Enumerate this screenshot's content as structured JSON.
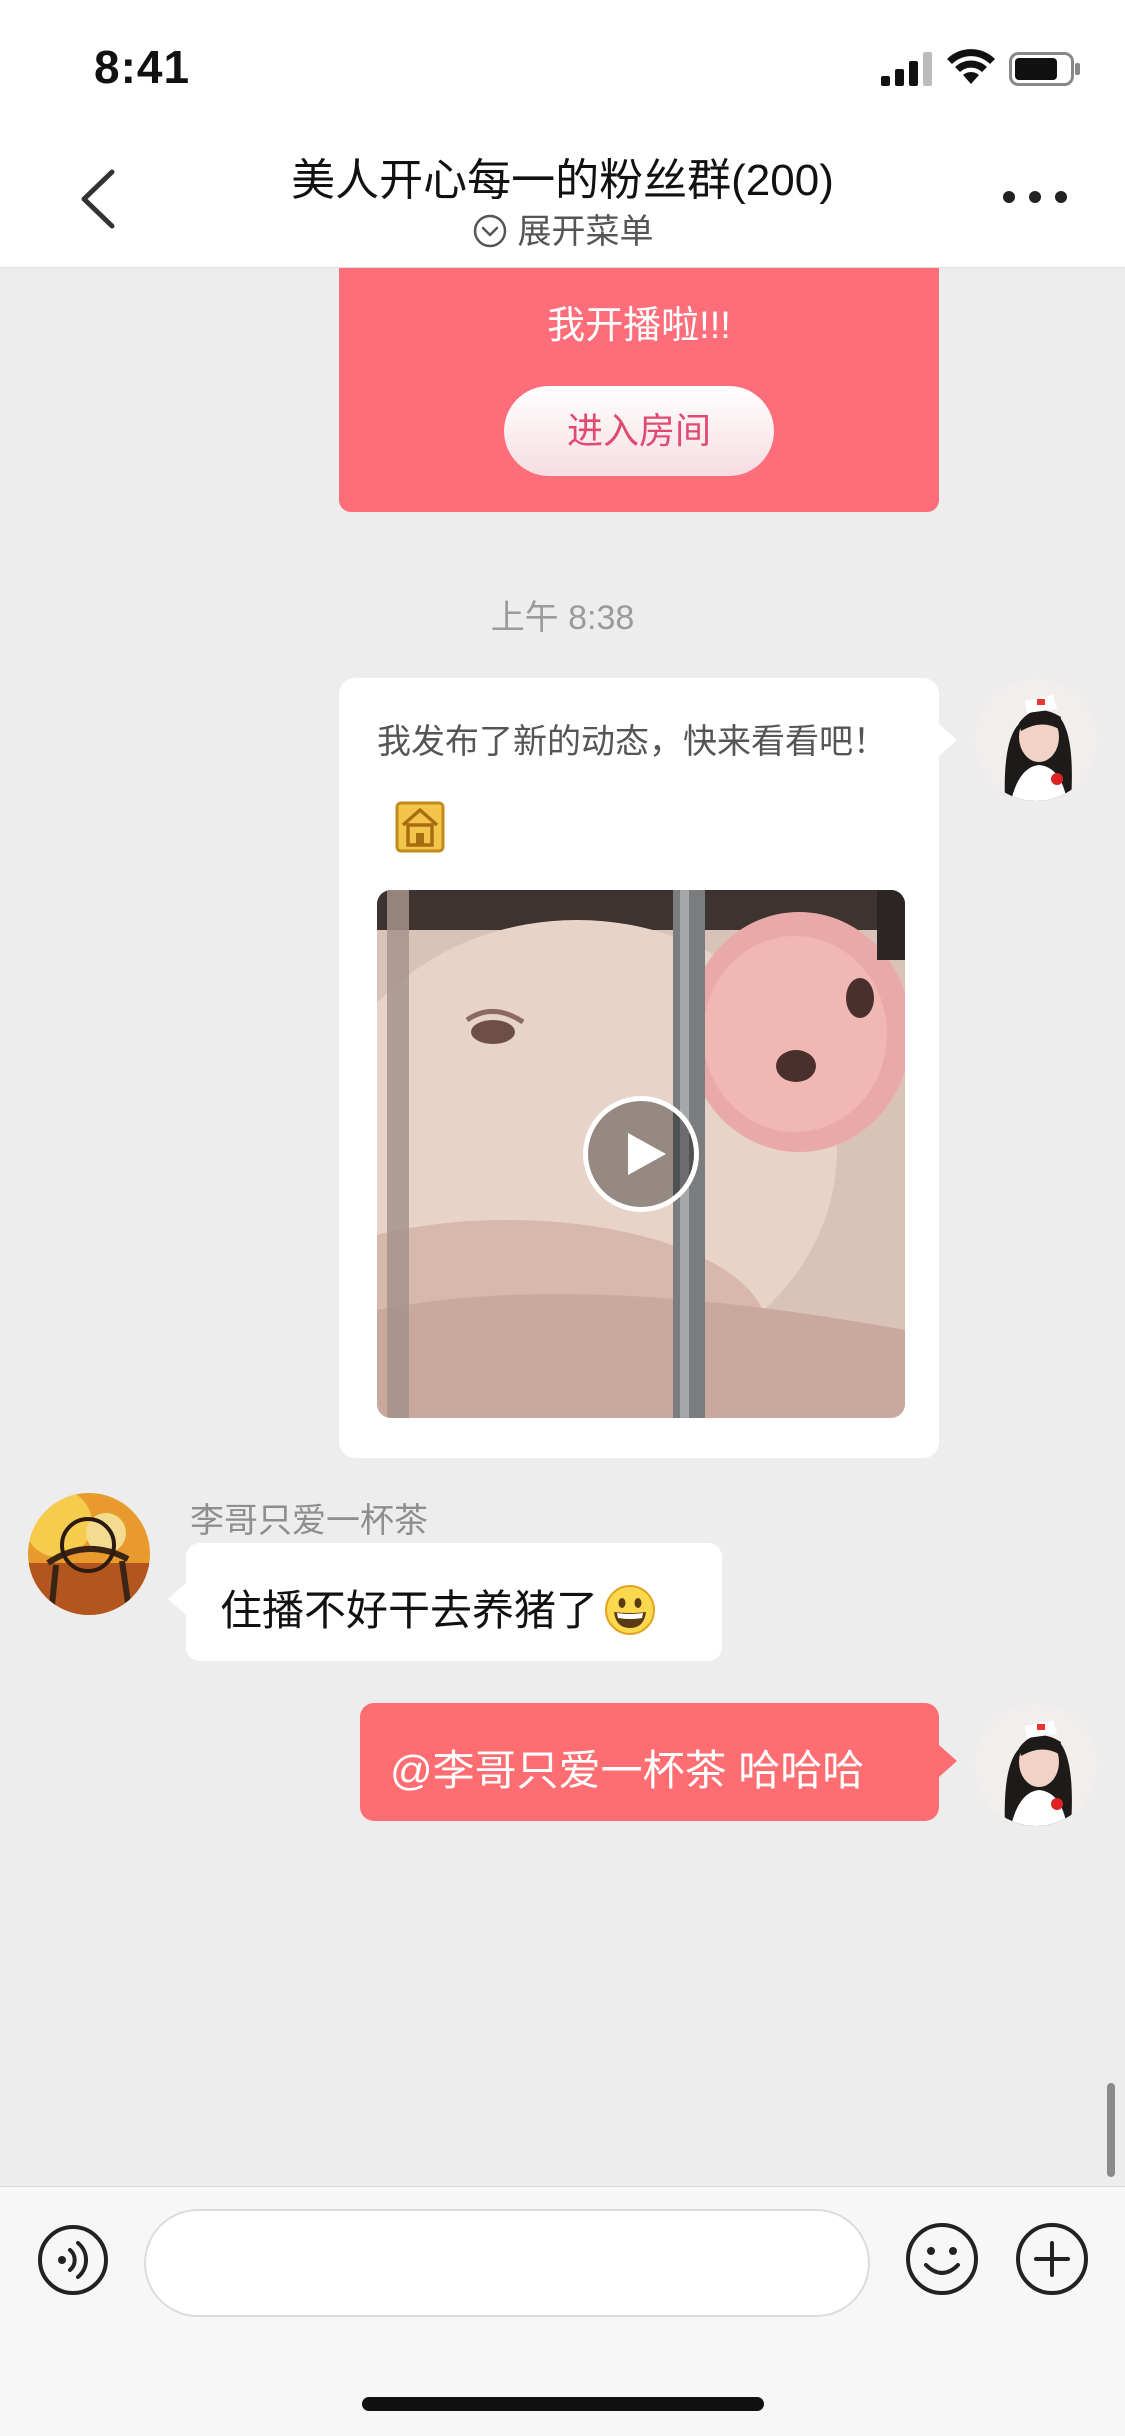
{
  "status_bar": {
    "time": "8:41"
  },
  "nav": {
    "title": "美人开心每一的粉丝群(200)",
    "subtitle": "展开菜单"
  },
  "live_card": {
    "text": "我开播啦!!!",
    "button_label": "进入房间"
  },
  "time_divider": "上午 8:38",
  "messages": [
    {
      "type": "post",
      "direction": "outgoing",
      "text": "我发布了新的动态，快来看看吧！",
      "has_video": true
    },
    {
      "type": "text",
      "direction": "incoming",
      "sender": "李哥只爱一杯茶",
      "text": "住播不好干去养猪了",
      "emoji": "grinning-face"
    },
    {
      "type": "text",
      "direction": "outgoing",
      "text": "@李哥只爱一杯茶 哈哈哈"
    }
  ],
  "input": {
    "placeholder": "",
    "value": ""
  },
  "colors": {
    "accent": "#fe6d72",
    "background": "#ededed",
    "bubble_incoming": "#ffffff"
  }
}
